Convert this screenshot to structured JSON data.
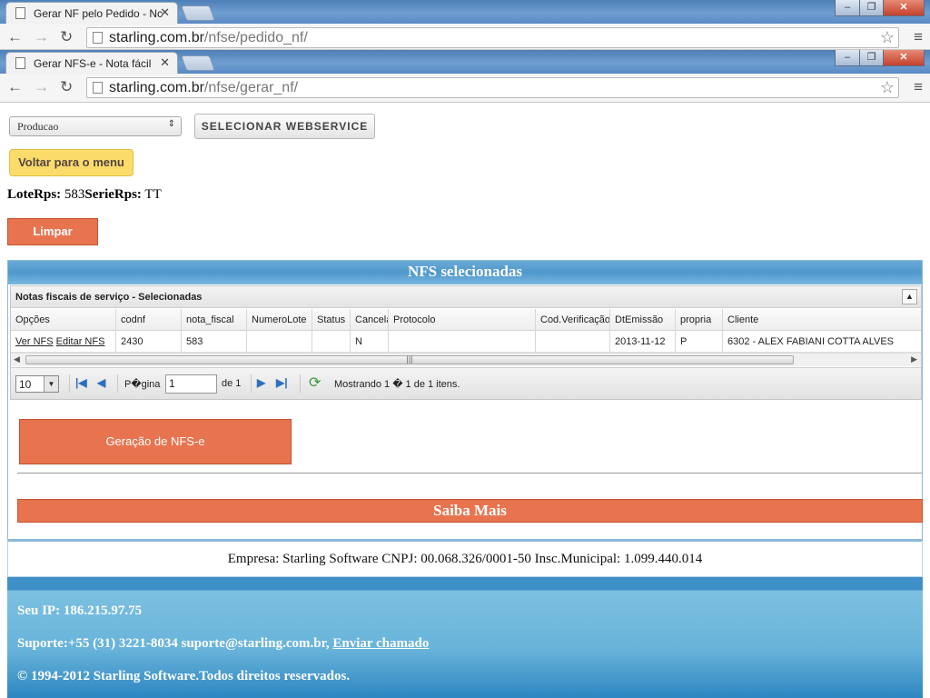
{
  "browser_back": {
    "tab_title": "Gerar NF pelo Pedido - Nc",
    "url_host": "starling.com.br",
    "url_path": "/nfse/pedido_nf/"
  },
  "browser_front": {
    "tab_title": "Gerar NFS-e - Nota fácil",
    "url_host": "starling.com.br",
    "url_path": "/nfse/gerar_nf/"
  },
  "icons": {
    "tab_close": "✕",
    "back": "←",
    "forward": "→",
    "reload": "↻",
    "star": "☆",
    "menu": "≡",
    "minimize": "–",
    "maximize": "❐",
    "close": "✕"
  },
  "controls": {
    "environment_select": "Producao",
    "webservice_button": "SELECIONAR WEBSERVICE",
    "back_to_menu": "Voltar para o menu",
    "clear_button": "Limpar"
  },
  "lote": {
    "lote_label": "LoteRps:",
    "lote_value": "583",
    "serie_label": "SerieRps:",
    "serie_value": "TT"
  },
  "panel": {
    "title": "NFS selecionadas",
    "grid_caption": "Notas fiscais de serviço - Selecionadas",
    "columns": [
      "Opções",
      "codnf",
      "nota_fiscal",
      "NumeroLote",
      "Status",
      "Cancela",
      "Protocolo",
      "Cod.Verificação",
      "DtEmissão",
      "propria",
      "Cliente"
    ],
    "row": {
      "ver_link": "Ver NFS",
      "editar_link": "Editar NFS",
      "codnf": "2430",
      "nota_fiscal": "583",
      "numero_lote": "",
      "status": "",
      "cancelada": "N",
      "protocolo": "",
      "cod_verificacao": "",
      "dt_emissao": "2013-11-12",
      "propria": "P",
      "cliente": "6302 - ALEX FABIANI COTTA ALVES"
    },
    "pager": {
      "page_size": "10",
      "page_label": "P�gina",
      "page_value": "1",
      "of_label": "de 1",
      "summary": "Mostrando 1 � 1 de 1 itens."
    },
    "generate_button": "Geração de NFS-e",
    "saiba_mais": "Saiba Mais"
  },
  "company_line": "Empresa: Starling Software CNPJ: 00.068.326/0001-50 Insc.Municipal: 1.099.440.014",
  "footer": {
    "ip_line": "Seu IP: 186.215.97.75",
    "support_text": "Suporte:+55 (31) 3221-8034 suporte@starling.com.br,",
    "support_link": "Enviar chamado",
    "copyright": "© 1994-2012 Starling Software.Todos direitos reservados."
  }
}
